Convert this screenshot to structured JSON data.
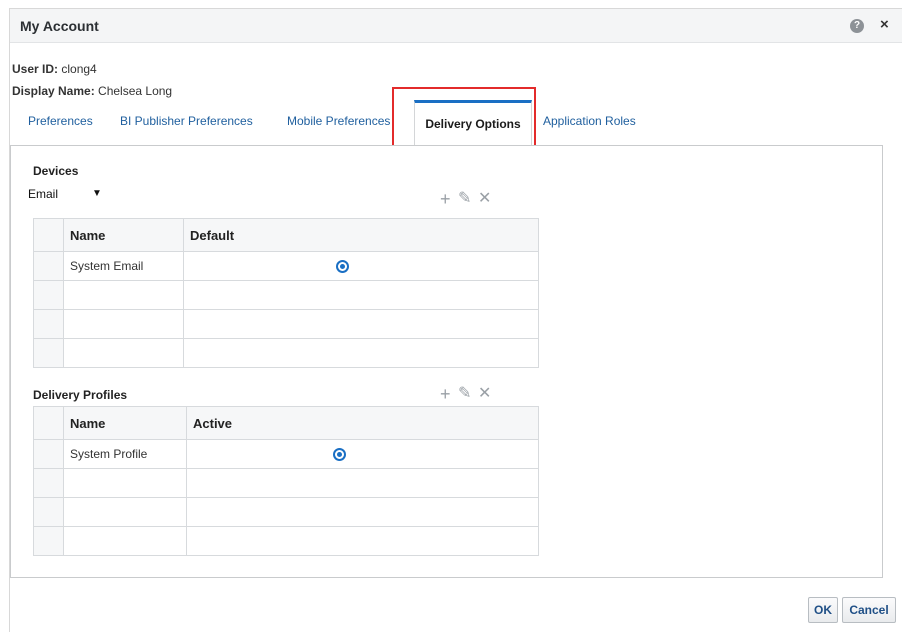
{
  "dialog": {
    "title": "My Account",
    "help_glyph": "?",
    "close_glyph": "×"
  },
  "user": {
    "id_label": "User ID:",
    "id_value": "clong4",
    "display_label": "Display Name:",
    "display_value": "Chelsea Long"
  },
  "tabs": [
    {
      "label": "Preferences"
    },
    {
      "label": "BI Publisher Preferences"
    },
    {
      "label": "Mobile Preferences"
    },
    {
      "label": "Delivery Options"
    },
    {
      "label": "Application Roles"
    }
  ],
  "active_tab": "Delivery Options",
  "devices": {
    "label": "Devices",
    "selected_type": "Email",
    "columns": [
      "Name",
      "Default"
    ],
    "rows": [
      {
        "name": "System Email",
        "default": true
      },
      {
        "name": "",
        "default": false
      },
      {
        "name": "",
        "default": false
      },
      {
        "name": "",
        "default": false
      }
    ]
  },
  "profiles": {
    "label": "Delivery Profiles",
    "columns": [
      "Name",
      "Active"
    ],
    "rows": [
      {
        "name": "System Profile",
        "active": true
      },
      {
        "name": "",
        "active": false
      },
      {
        "name": "",
        "active": false
      },
      {
        "name": "",
        "active": false
      }
    ]
  },
  "toolbar_icons": [
    "add-icon",
    "edit-icon",
    "delete-icon"
  ],
  "toolbar_glyphs": {
    "add": "+",
    "edit": "✎",
    "delete": "✕"
  },
  "footer": {
    "ok_label": "OK",
    "cancel_label": "Cancel"
  },
  "colors": {
    "accent": "#1a6fc4",
    "highlight": "#e32b2b",
    "link": "#1f5f9e"
  }
}
